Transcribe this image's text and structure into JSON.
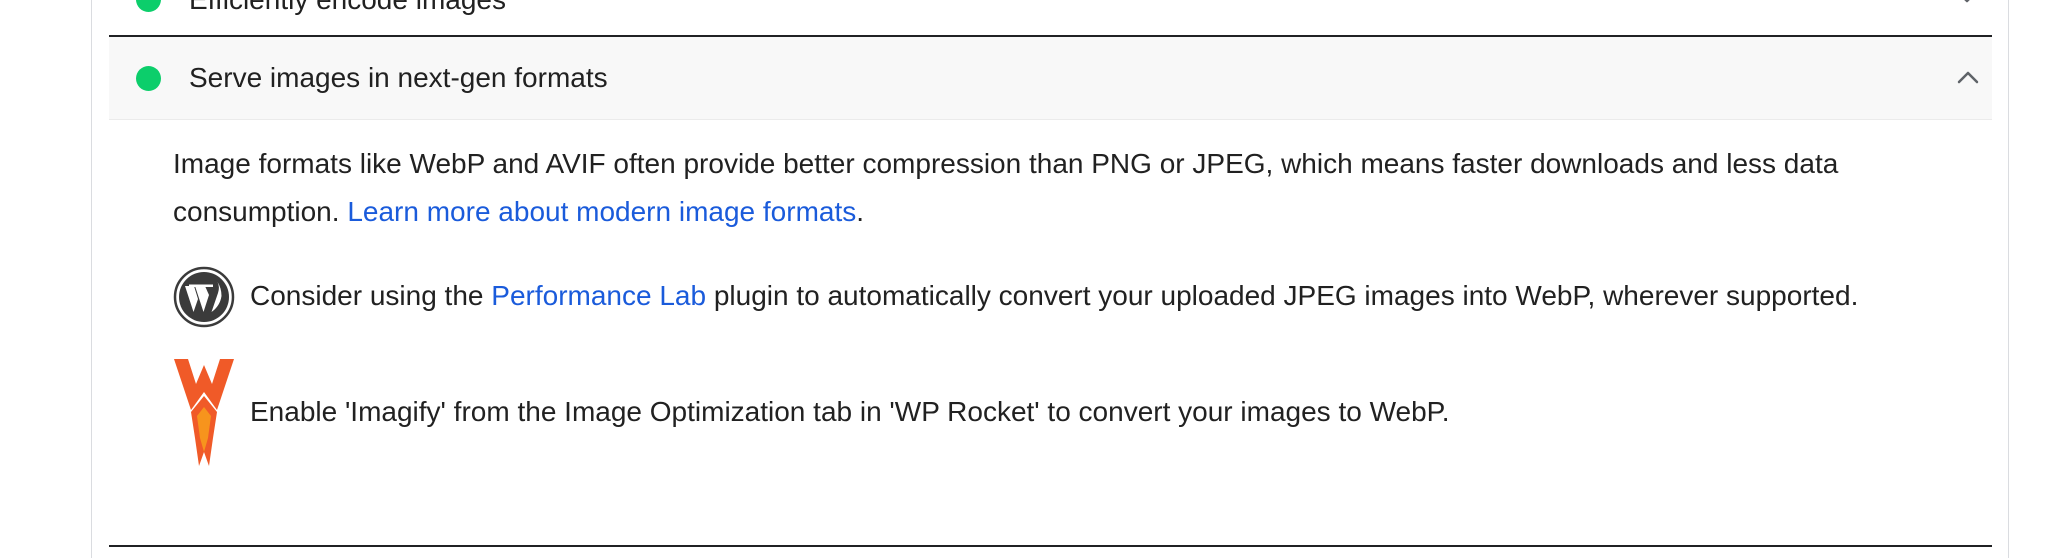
{
  "previous_audit": {
    "title": "Efficiently encode images",
    "status_color": "#0cce6b",
    "icon": "chevron-down-icon"
  },
  "audit": {
    "title": "Serve images in next-gen formats",
    "status_color": "#0cce6b",
    "expanded": true,
    "icon": "chevron-up-icon",
    "description_text": "Image formats like WebP and AVIF often provide better compression than PNG or JPEG, which means faster downloads and less data consumption. ",
    "learn_more_link": "Learn more about modern image formats",
    "description_end": "."
  },
  "stack_packs": {
    "wordpress": {
      "icon": "wordpress-icon",
      "text_before": "Consider using the ",
      "link": "Performance Lab",
      "text_after": " plugin to automatically convert your uploaded JPEG images into WebP, wherever supported."
    },
    "wp_rocket": {
      "icon": "wp-rocket-icon",
      "text": "Enable 'Imagify' from the Image Optimization tab in 'WP Rocket' to convert your images to WebP."
    }
  },
  "colors": {
    "pass": "#0cce6b",
    "link": "#1a5bdb",
    "rocket_primary": "#f05a28",
    "rocket_secondary": "#f7941d"
  }
}
